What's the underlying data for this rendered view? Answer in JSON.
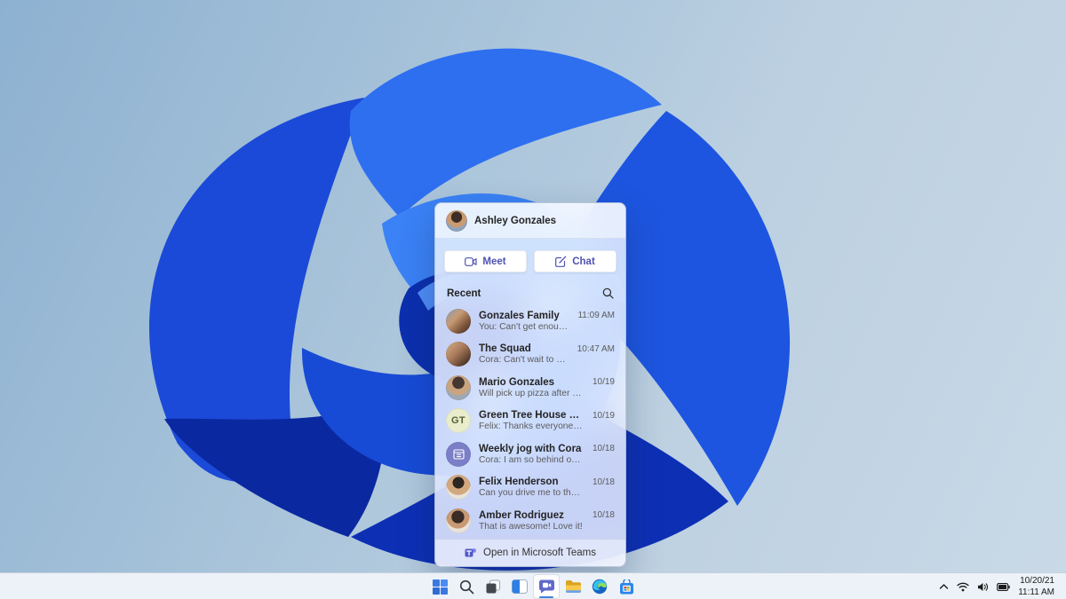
{
  "chat_flyout": {
    "header": {
      "name": "Ashley Gonzales",
      "avatar": "photo"
    },
    "actions": [
      {
        "label": "Meet",
        "icon": "video-camera-icon"
      },
      {
        "label": "Chat",
        "icon": "compose-icon"
      }
    ],
    "recent_label": "Recent",
    "search_icon": "search-icon",
    "conversations": [
      {
        "name": "Gonzales Family",
        "preview": "You: Can't get enough of her.",
        "time": "11:09 AM",
        "avatar": "photo-group"
      },
      {
        "name": "The Squad",
        "preview": "Cora: Can't wait to see everyone!",
        "time": "10:47 AM",
        "avatar": "photo-group"
      },
      {
        "name": "Mario Gonzales",
        "preview": "Will pick up pizza after my practice.",
        "time": "10/19",
        "avatar": "photo"
      },
      {
        "name": "Green Tree House PTA",
        "preview": "Felix: Thanks everyone for attending today.",
        "time": "10/19",
        "avatar": "initials",
        "avatar_initials": "GT"
      },
      {
        "name": "Weekly jog with Cora",
        "preview": "Cora: I am so behind on my step goals.",
        "time": "10/18",
        "avatar": "calendar-icon"
      },
      {
        "name": "Felix Henderson",
        "preview": "Can you drive me to the PTA today?",
        "time": "10/18",
        "avatar": "photo"
      },
      {
        "name": "Amber Rodriguez",
        "preview": "That is awesome! Love it!",
        "time": "10/18",
        "avatar": "photo"
      }
    ],
    "footer_label": "Open in Microsoft Teams",
    "footer_icon": "teams-logo-icon"
  },
  "taskbar": {
    "icons": [
      {
        "name": "start",
        "active": false
      },
      {
        "name": "search",
        "active": false
      },
      {
        "name": "task-view",
        "active": false
      },
      {
        "name": "widgets",
        "active": false
      },
      {
        "name": "teams-chat",
        "active": true
      },
      {
        "name": "file-explorer",
        "active": false
      },
      {
        "name": "microsoft-edge",
        "active": false
      },
      {
        "name": "microsoft-store",
        "active": false
      }
    ],
    "tray": {
      "chevron": "show-hidden-icons",
      "icons": [
        "wifi-icon",
        "volume-icon",
        "battery-icon"
      ],
      "date": "10/20/21",
      "time": "11:11 AM"
    }
  },
  "colors": {
    "accent_teams": "#4f52b2",
    "active_indicator": "#3f82d6",
    "taskbar_bg": "#edf2f8",
    "sky_light": "#c9d9e7",
    "sky_dark": "#8db1d1",
    "bloom_bright": "#3b82f6",
    "bloom_mid": "#2563eb",
    "bloom_deep": "#0b2fae"
  }
}
